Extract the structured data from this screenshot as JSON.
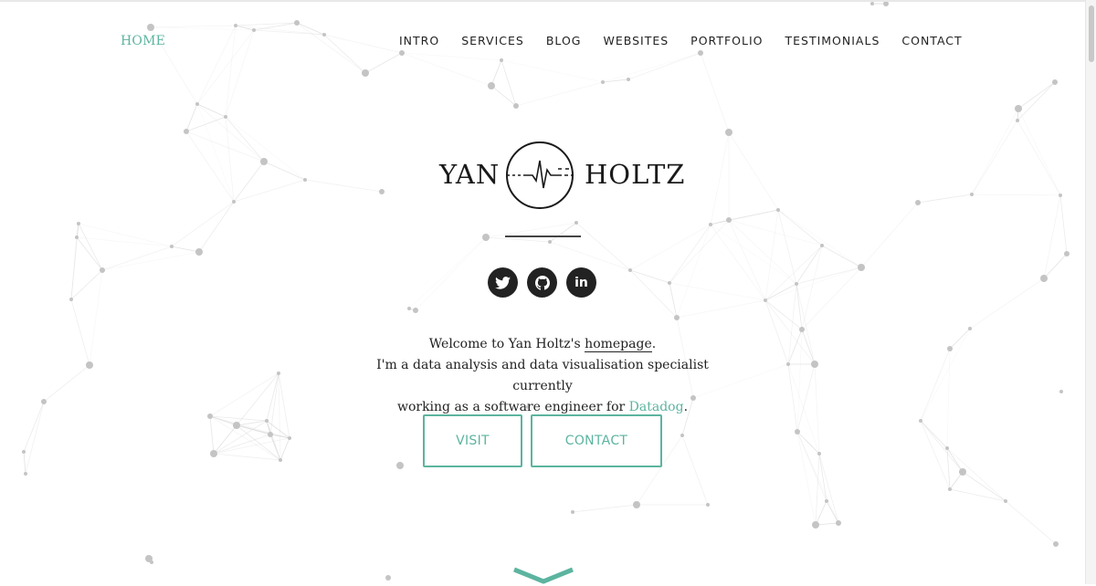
{
  "nav": {
    "home": "HOME",
    "items": [
      "INTRO",
      "SERVICES",
      "BLOG",
      "WEBSITES",
      "PORTFOLIO",
      "TESTIMONIALS",
      "CONTACT"
    ]
  },
  "logo": {
    "first": "YAN",
    "last": "HOLTZ",
    "mark_icon": "heartbeat-circle-icon"
  },
  "social": [
    {
      "name": "twitter",
      "icon": "twitter-icon"
    },
    {
      "name": "github",
      "icon": "github-icon"
    },
    {
      "name": "linkedin",
      "icon": "linkedin-icon",
      "glyph": "in"
    }
  ],
  "intro": {
    "line1_pre": "Welcome to Yan Holtz's ",
    "line1_link": "homepage",
    "line1_post": ".",
    "line2": "I'm a data analysis and data visualisation specialist currently",
    "line3_pre": "working as a software engineer for ",
    "line3_link": "Datadog",
    "line3_post": "."
  },
  "buttons": {
    "visit": "VISIT",
    "contact": "CONTACT"
  },
  "scroll_icon": "chevron-down-icon",
  "colors": {
    "accent": "#5cb49f",
    "text": "#222222",
    "network": "#cfcfcf"
  }
}
